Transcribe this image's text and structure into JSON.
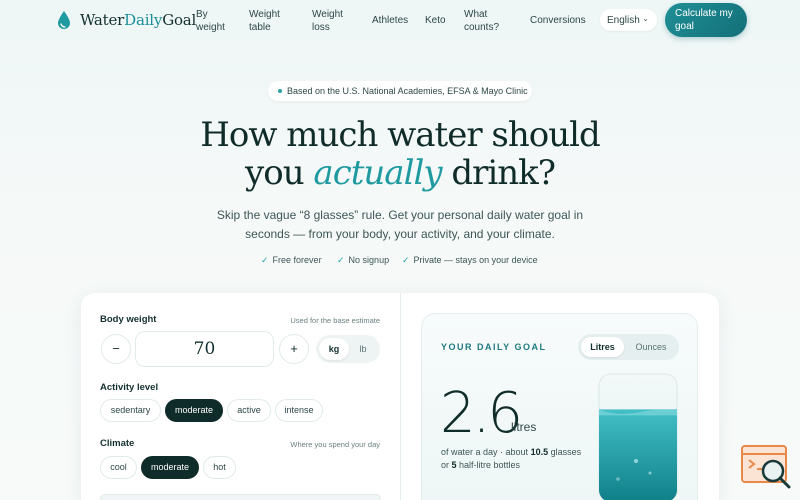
{
  "nav": {
    "brand_part1": "Water",
    "brand_part2": "Daily",
    "brand_part3": "Goal",
    "links": [
      "By weight",
      "Weight table",
      "Weight loss",
      "Athletes",
      "Keto",
      "What counts?",
      "Conversions"
    ],
    "language": "English",
    "cta": "Calculate my goal"
  },
  "hero": {
    "badge": "Based on the U.S. National Academies, EFSA & Mayo Clinic",
    "headline_line1": "How much water should",
    "headline_you": "you ",
    "headline_em": "actually",
    "headline_end": " drink?",
    "subtitle": "Skip the vague “8 glasses” rule. Get your personal daily water goal in seconds — from your body, your activity, and your climate.",
    "checks": [
      "Free forever",
      "No signup",
      "Private — stays on your device"
    ]
  },
  "form": {
    "weight_label": "Body weight",
    "weight_hint": "Used for the base estimate",
    "weight_value": "70",
    "minus": "−",
    "plus": "+",
    "units": [
      "kg",
      "lb"
    ],
    "selected_unit": "kg",
    "activity_label": "Activity level",
    "activity_options": [
      "sedentary",
      "moderate",
      "active",
      "intense"
    ],
    "activity_selected": "moderate",
    "climate_label": "Climate",
    "climate_hint": "Where you spend your day",
    "climate_options": [
      "cool",
      "moderate",
      "hot"
    ],
    "climate_selected": "moderate"
  },
  "goal": {
    "title": "YOUR DAILY GOAL",
    "unit_options": [
      "Litres",
      "Ounces"
    ],
    "unit_selected": "Litres",
    "value": "2.6",
    "unit": "litres",
    "desc_prefix": "of water a day · about ",
    "glasses": "10.5",
    "desc_mid": " glasses or ",
    "bottles": "5",
    "desc_suffix": " half-litre bottles",
    "fill_level": 0.72
  },
  "colors": {
    "accent": "#1f9aa1",
    "dark": "#0f2b2a",
    "widget": "#e8894a"
  },
  "icons": {
    "brand": "water-drop-icon",
    "language_chevron": "chevron-down-icon",
    "check": "check-icon",
    "widget": "chat-search-icon"
  }
}
